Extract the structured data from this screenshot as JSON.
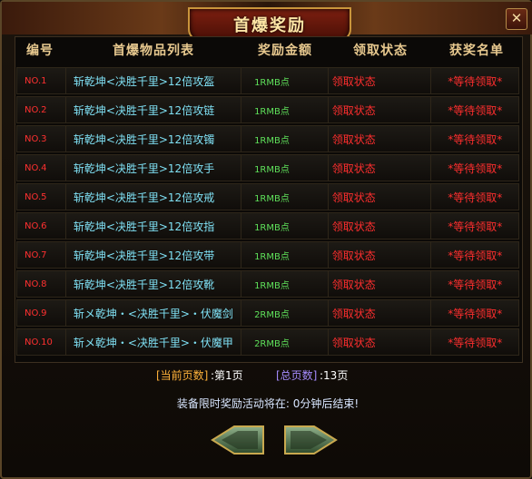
{
  "window": {
    "title": "首爆奖励",
    "close_label": "✕"
  },
  "table": {
    "headers": [
      "编号",
      "首爆物品列表",
      "奖励金额",
      "领取状态",
      "获奖名单"
    ],
    "rows": [
      {
        "no": "NO.1",
        "item": "斩乾坤<决胜千里>12倍攻盔",
        "reward": "1RMB点",
        "status": "领取状态",
        "winner": "*等待领取*"
      },
      {
        "no": "NO.2",
        "item": "斩乾坤<决胜千里>12倍攻链",
        "reward": "1RMB点",
        "status": "领取状态",
        "winner": "*等待领取*"
      },
      {
        "no": "NO.3",
        "item": "斩乾坤<决胜千里>12倍攻镯",
        "reward": "1RMB点",
        "status": "领取状态",
        "winner": "*等待领取*"
      },
      {
        "no": "NO.4",
        "item": "斩乾坤<决胜千里>12倍攻手",
        "reward": "1RMB点",
        "status": "领取状态",
        "winner": "*等待领取*"
      },
      {
        "no": "NO.5",
        "item": "斩乾坤<决胜千里>12倍攻戒",
        "reward": "1RMB点",
        "status": "领取状态",
        "winner": "*等待领取*"
      },
      {
        "no": "NO.6",
        "item": "斩乾坤<决胜千里>12倍攻指",
        "reward": "1RMB点",
        "status": "领取状态",
        "winner": "*等待领取*"
      },
      {
        "no": "NO.7",
        "item": "斩乾坤<决胜千里>12倍攻带",
        "reward": "1RMB点",
        "status": "领取状态",
        "winner": "*等待领取*"
      },
      {
        "no": "NO.8",
        "item": "斩乾坤<决胜千里>12倍攻靴",
        "reward": "1RMB点",
        "status": "领取状态",
        "winner": "*等待领取*"
      },
      {
        "no": "NO.9",
        "item": "斩メ乾坤・<决胜千里>・伏魔剑",
        "reward": "2RMB点",
        "status": "领取状态",
        "winner": "*等待领取*"
      },
      {
        "no": "NO.10",
        "item": "斩メ乾坤・<决胜千里>・伏魔甲",
        "reward": "2RMB点",
        "status": "领取状态",
        "winner": "*等待领取*"
      }
    ]
  },
  "pager": {
    "current_label": "[当前页数]",
    "current_value": ":第1页",
    "total_label": "[总页数]",
    "total_value": ":13页"
  },
  "notice": "装备限时奖励活动将在: 0分钟后结束!",
  "nav": {
    "prev_icon": "arrow-left-icon",
    "next_icon": "arrow-right-icon"
  },
  "colors": {
    "number": "#ff3030",
    "item": "#7fe0f4",
    "reward": "#5ee05a",
    "status": "#ff2e2e",
    "header": "#e8c98f",
    "pager_current": "#ffb23a",
    "pager_total": "#a68cff"
  }
}
